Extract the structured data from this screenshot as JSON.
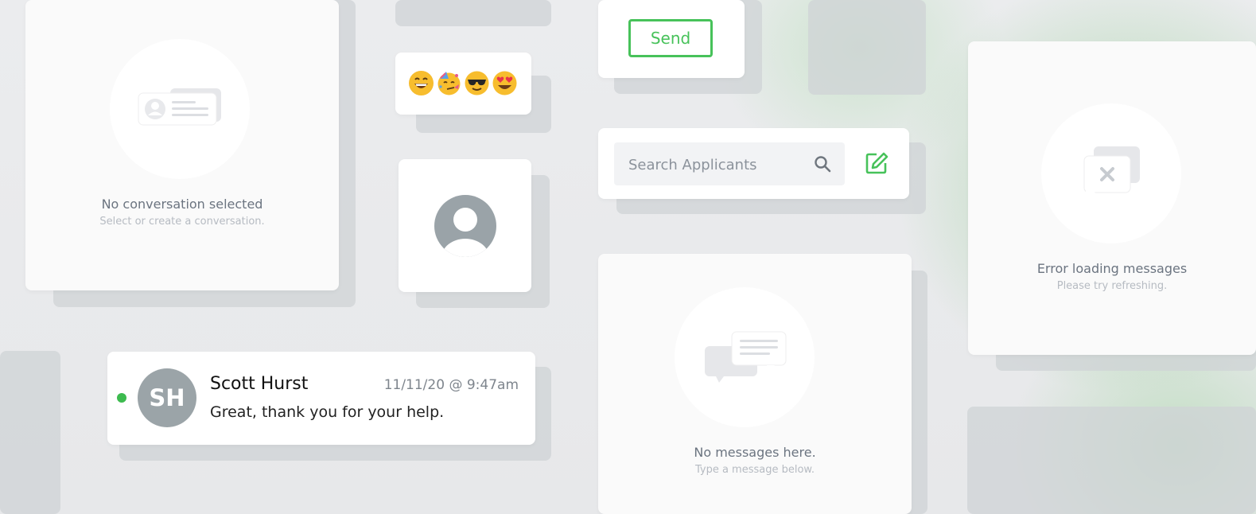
{
  "colors": {
    "accent": "#47c25a",
    "online": "#3dbb4f",
    "avatar_gray": "#9ba4a8"
  },
  "empty_conversation": {
    "icon": "contact-card-icon",
    "title": "No conversation selected",
    "subtitle": "Select or create a conversation."
  },
  "emoji_picker": {
    "emojis": [
      "😄",
      "🥳",
      "😎",
      "😍"
    ]
  },
  "profile_placeholder": {
    "icon": "user-avatar-icon"
  },
  "send_button": {
    "label": "Send"
  },
  "search": {
    "placeholder": "Search Applicants",
    "search_icon": "search-icon",
    "compose_icon": "compose-icon"
  },
  "conversation_item": {
    "initials": "SH",
    "name": "Scott Hurst",
    "timestamp": "11/11/20 @ 9:47am",
    "preview": "Great, thank you for your help.",
    "status": "online"
  },
  "empty_messages": {
    "icon": "chat-bubbles-icon",
    "title": "No messages here.",
    "subtitle": "Type a message below."
  },
  "error_messages": {
    "icon": "chat-error-icon",
    "title": "Error loading messages",
    "subtitle": "Please try refreshing."
  }
}
